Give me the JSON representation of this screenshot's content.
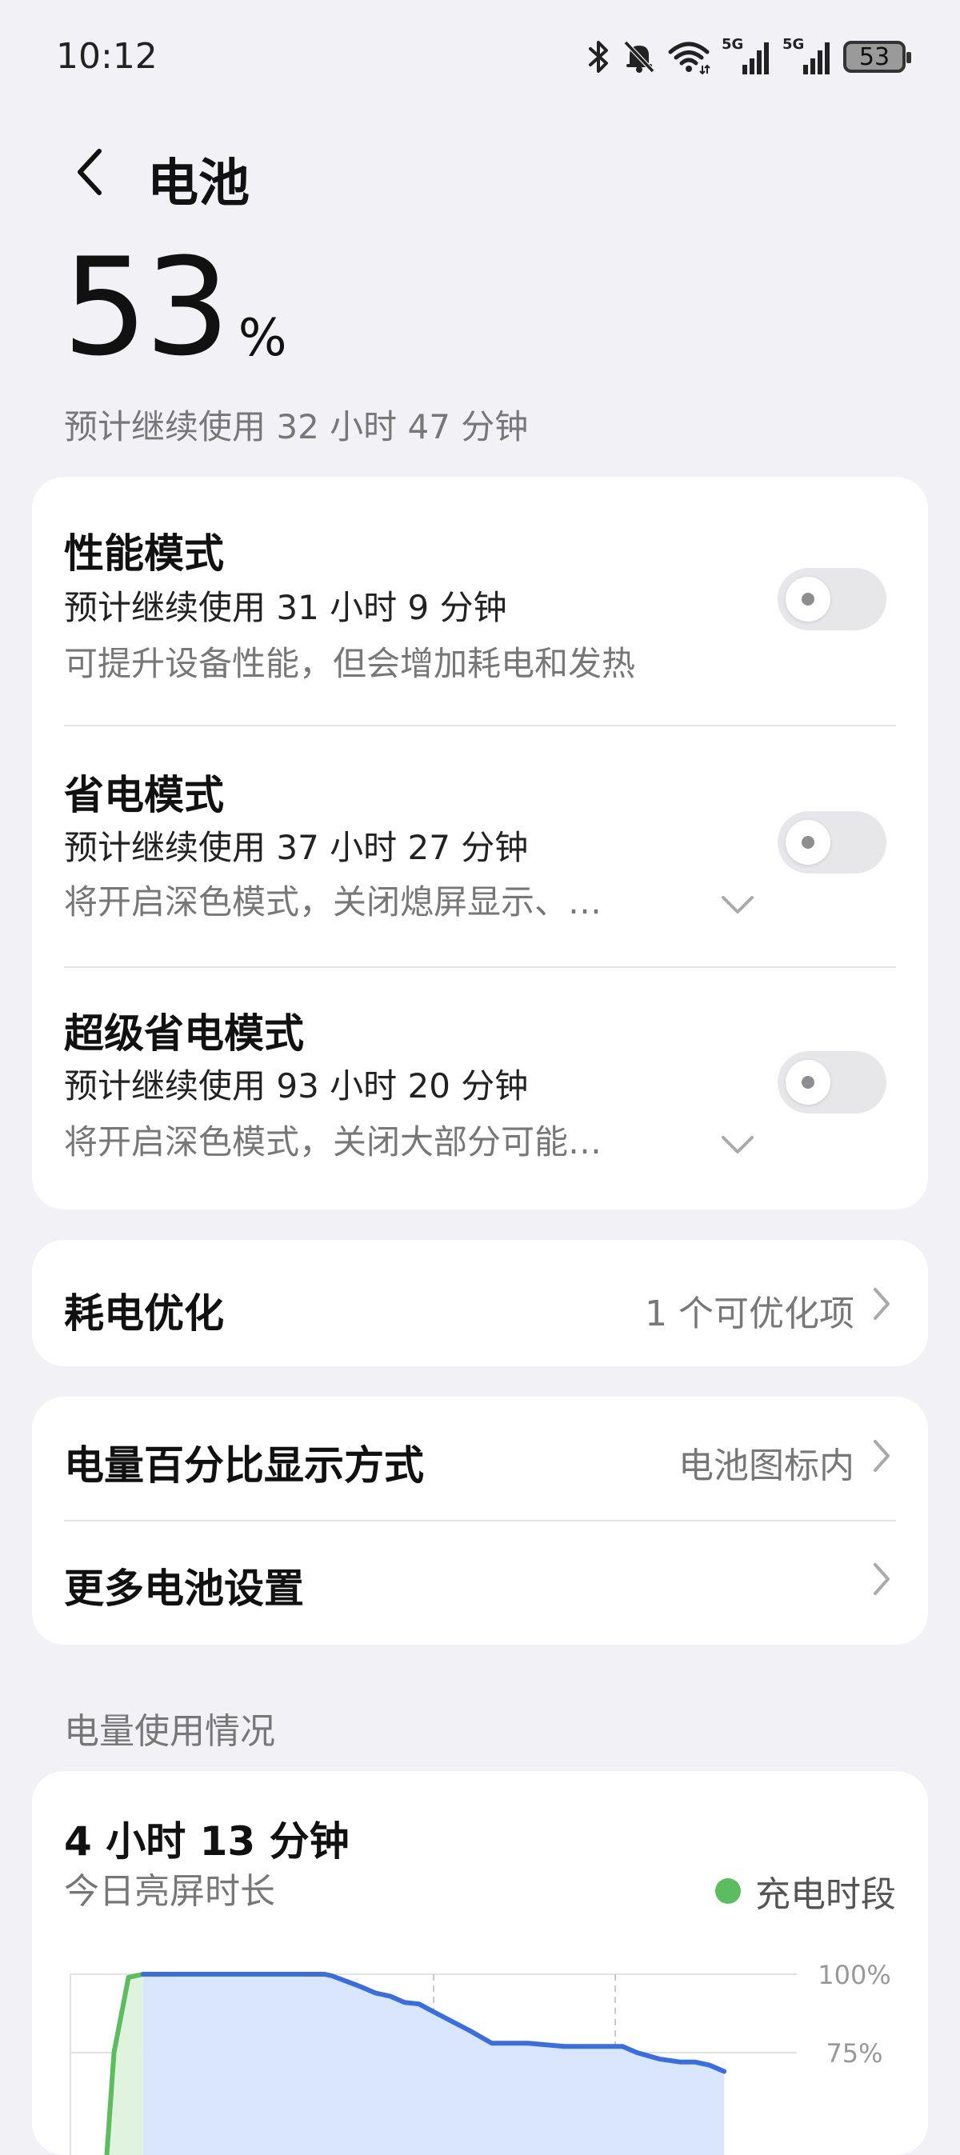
{
  "status_bar": {
    "time": "10:12",
    "battery_level": "53",
    "network_1": "5G",
    "network_2": "5G"
  },
  "header": {
    "title": "电池"
  },
  "battery": {
    "percent": "53",
    "unit": "%",
    "estimate": "预计继续使用 32 小时 47 分钟"
  },
  "modes": [
    {
      "title": "性能模式",
      "estimate": "预计继续使用 31 小时 9 分钟",
      "description": "可提升设备性能，但会增加耗电和发热",
      "enabled": false
    },
    {
      "title": "省电模式",
      "estimate": "预计继续使用 37 小时 27 分钟",
      "description": "将开启深色模式，关闭熄屏显示、…",
      "enabled": false
    },
    {
      "title": "超级省电模式",
      "estimate": "预计继续使用 93 小时 20 分钟",
      "description": "将开启深色模式，关闭大部分可能…",
      "enabled": false
    }
  ],
  "optimization": {
    "label": "耗电优化",
    "value": "1 个可优化项"
  },
  "settings": {
    "percent_display_label": "电量百分比显示方式",
    "percent_display_value": "电池图标内",
    "more_settings_label": "更多电池设置"
  },
  "usage": {
    "section_title": "电量使用情况",
    "screen_on_duration": "4 小时 13 分钟",
    "screen_on_label": "今日亮屏时长",
    "legend_label": "充电时段"
  },
  "colors": {
    "charge_line": "#5cbd5e",
    "charge_fill": "#dff3df",
    "discharge_line": "#3a6ee0",
    "discharge_fill": "#dae6fd"
  },
  "chart_data": {
    "type": "area",
    "ytick_labels": [
      "100%",
      "75%"
    ],
    "ylim": [
      0,
      100
    ],
    "xlim": [
      0,
      100
    ],
    "grid": true,
    "series": [
      {
        "name": "充电时段",
        "x": [
          5,
          6,
          8,
          10
        ],
        "values": [
          42,
          75,
          99,
          100
        ]
      },
      {
        "x": [
          10,
          12,
          15,
          19,
          22,
          25,
          30,
          35,
          36,
          40,
          42,
          44,
          46,
          48,
          50,
          55,
          58,
          63,
          68,
          73,
          76,
          78,
          81,
          84,
          86,
          88,
          90
        ],
        "values": [
          100,
          100,
          100,
          100,
          100,
          100,
          100,
          100,
          99.5,
          96,
          94,
          93,
          91,
          90.5,
          88,
          82,
          78,
          78,
          77,
          77,
          77,
          75,
          73,
          72,
          72,
          71,
          69
        ]
      }
    ]
  }
}
